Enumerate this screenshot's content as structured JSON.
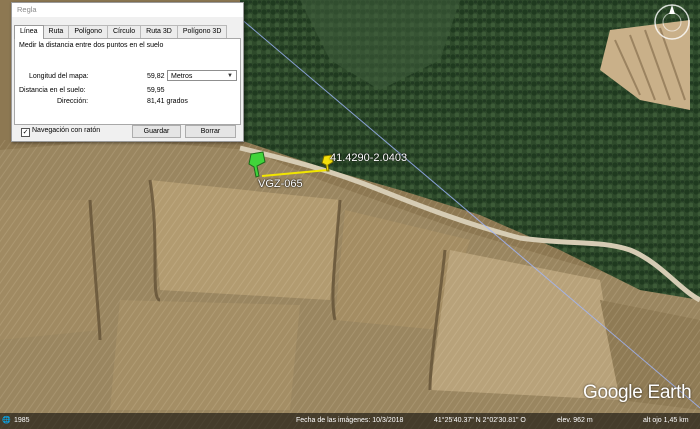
{
  "ruler": {
    "title": "Regla",
    "tabs": [
      "Línea",
      "Ruta",
      "Polígono",
      "Círculo",
      "Ruta 3D",
      "Polígono 3D"
    ],
    "description": "Medir la distancia entre dos puntos en el suelo",
    "map_length_label": "Longitud del mapa:",
    "map_length_value": "59,82",
    "unit": "Metros",
    "ground_distance_label": "Distancia en el suelo:",
    "ground_distance_value": "59,95",
    "direction_label": "Dirección:",
    "direction_value": "81,41 grados",
    "mouse_nav_label": "Navegación con ratón",
    "mouse_nav_checked": true,
    "save_label": "Guardar",
    "clear_label": "Borrar"
  },
  "map": {
    "placemark_green_label": "VGZ-065",
    "placemark_yellow_label": "41.4290-2.0403",
    "brand": "Google Earth"
  },
  "statusbar": {
    "year": "1985",
    "imagery_date": "Fecha de las imágenes: 10/3/2018",
    "coordinates": "41°25'40.37\" N    2°02'30.81\" O",
    "elevation": "elev.   962 m",
    "eye_altitude": "alt ojo  1,45 km"
  },
  "colors": {
    "measure_line": "#f2e600",
    "placemark_green": "#41d43a",
    "placemark_yellow": "#f4e10a"
  }
}
